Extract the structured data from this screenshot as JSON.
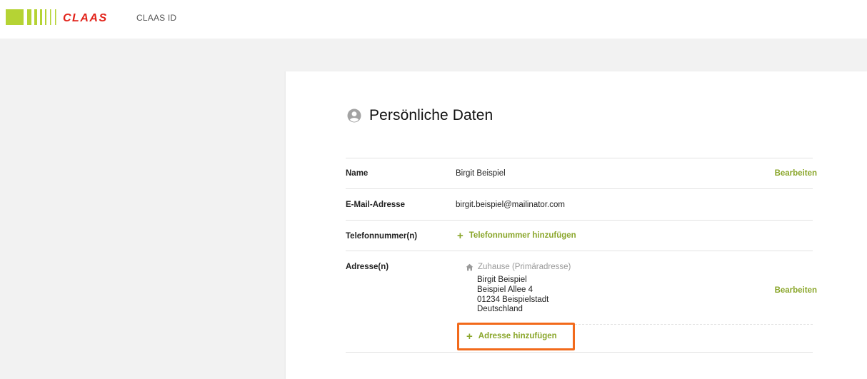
{
  "header": {
    "logo_text": "CLAAS",
    "app_name": "CLAAS ID"
  },
  "colors": {
    "brand_green": "#b5d334",
    "brand_red": "#e2231a",
    "link_green": "#8aa62a",
    "highlight_orange": "#f26a1b"
  },
  "page": {
    "title": "Persönliche Daten",
    "title_icon": "user-circle-icon"
  },
  "rows": {
    "name": {
      "label": "Name",
      "value": "Birgit Beispiel",
      "action": "Bearbeiten"
    },
    "email": {
      "label": "E-Mail-Adresse",
      "value": "birgit.beispiel@mailinator.com"
    },
    "phone": {
      "label": "Telefonnummer(n)",
      "add_label": "Telefonnummer hinzufügen"
    },
    "address": {
      "label": "Adresse(n)",
      "type": "Zuhause (Primäradresse)",
      "type_icon": "home-icon",
      "line1": "Birgit Beispiel",
      "line2": "Beispiel Allee 4",
      "line3": "01234 Beispielstadt",
      "line4": "Deutschland",
      "action": "Bearbeiten",
      "add_label": "Adresse hinzufügen"
    }
  }
}
